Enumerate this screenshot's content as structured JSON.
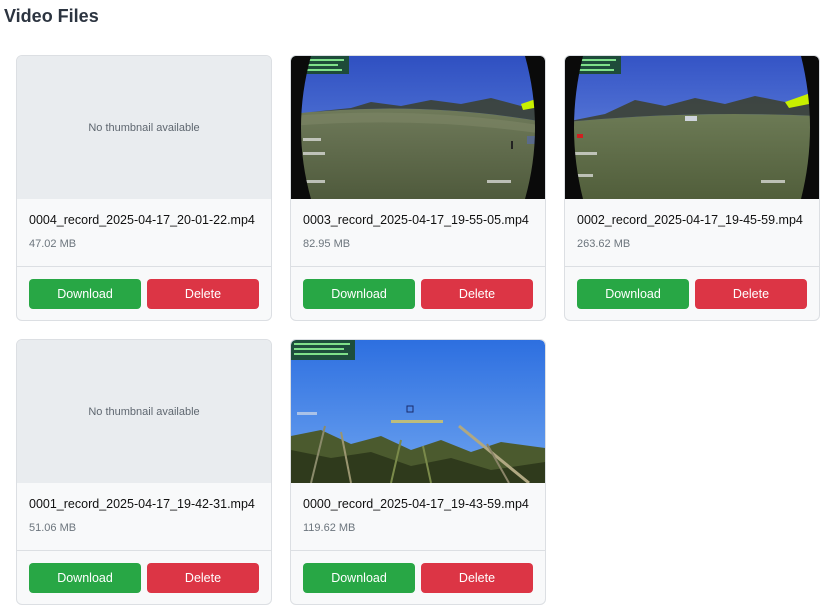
{
  "page": {
    "title": "Video Files"
  },
  "no_thumbnail_text": "No thumbnail available",
  "videos": [
    {
      "file_name": "0004_record_2025-04-17_20-01-22.mp4",
      "size": "47.02 MB",
      "thumbnail": "none"
    },
    {
      "file_name": "0003_record_2025-04-17_19-55-05.mp4",
      "size": "82.95 MB",
      "thumbnail": "fpv-field-car"
    },
    {
      "file_name": "0002_record_2025-04-17_19-45-59.mp4",
      "size": "263.62 MB",
      "thumbnail": "fpv-field"
    },
    {
      "file_name": "0001_record_2025-04-17_19-42-31.mp4",
      "size": "51.06 MB",
      "thumbnail": "none"
    },
    {
      "file_name": "0000_record_2025-04-17_19-43-59.mp4",
      "size": "119.62 MB",
      "thumbnail": "fpv-sky-grass"
    }
  ],
  "buttons": {
    "download_label": "Download",
    "delete_label": "Delete"
  },
  "colors": {
    "download": "#28a745",
    "delete": "#dc3545",
    "card_background": "#f8f9fa",
    "placeholder_background": "#e9ecef"
  }
}
